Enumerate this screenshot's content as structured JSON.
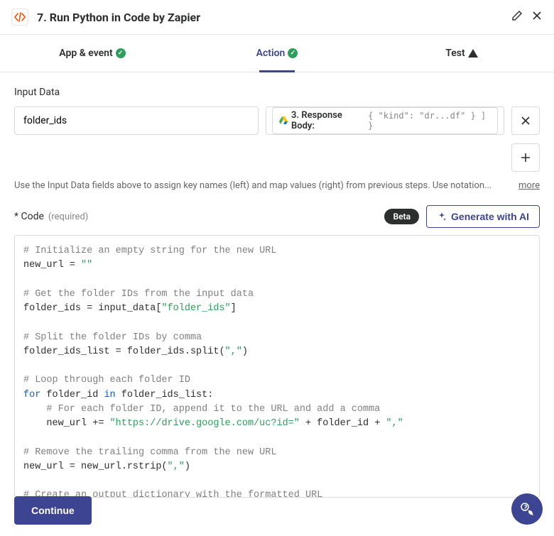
{
  "header": {
    "title": "7. Run Python in Code by Zapier"
  },
  "tabs": {
    "app_event": "App & event",
    "action": "Action",
    "test": "Test"
  },
  "input": {
    "section_label": "Input Data",
    "key_value": "folder_ids",
    "pill_label": "3. Response Body:",
    "pill_preview": "{  \"kind\": \"dr...df\"   } ] }",
    "help_text": "Use the Input Data fields above to assign key names (left) and map values (right) from previous steps. Use notation...",
    "more": "more"
  },
  "code": {
    "label": "* Code",
    "required": "(required)",
    "beta": "Beta",
    "generate": "Generate with AI",
    "lines": [
      {
        "t": "comment",
        "v": "# Initialize an empty string for the new URL"
      },
      {
        "t": "assign",
        "lhs": "new_url = ",
        "str": "\"\""
      },
      {
        "t": "blank"
      },
      {
        "t": "comment",
        "v": "# Get the folder IDs from the input data"
      },
      {
        "t": "assign",
        "lhs": "folder_ids = input_data[",
        "str": "\"folder_ids\"",
        "rhs": "]"
      },
      {
        "t": "blank"
      },
      {
        "t": "comment",
        "v": "# Split the folder IDs by comma"
      },
      {
        "t": "assign",
        "lhs": "folder_ids_list = folder_ids.split(",
        "str": "\",\"",
        "rhs": ")"
      },
      {
        "t": "blank"
      },
      {
        "t": "comment",
        "v": "# Loop through each folder ID"
      },
      {
        "t": "for",
        "kw1": "for",
        "mid": " folder_id ",
        "kw2": "in",
        "rest": " folder_ids_list:"
      },
      {
        "t": "comment",
        "v": "    # For each folder ID, append it to the URL and add a comma"
      },
      {
        "t": "assign",
        "lhs": "    new_url += ",
        "str": "\"https://drive.google.com/uc?id=\"",
        "rhs": " + folder_id + ",
        "str2": "\",\""
      },
      {
        "t": "blank"
      },
      {
        "t": "comment",
        "v": "# Remove the trailing comma from the new URL"
      },
      {
        "t": "assign",
        "lhs": "new_url = new_url.rstrip(",
        "str": "\",\"",
        "rhs": ")"
      },
      {
        "t": "blank"
      },
      {
        "t": "comment",
        "v": "# Create an output dictionary with the formatted URL"
      }
    ]
  },
  "footer": {
    "continue": "Continue"
  }
}
